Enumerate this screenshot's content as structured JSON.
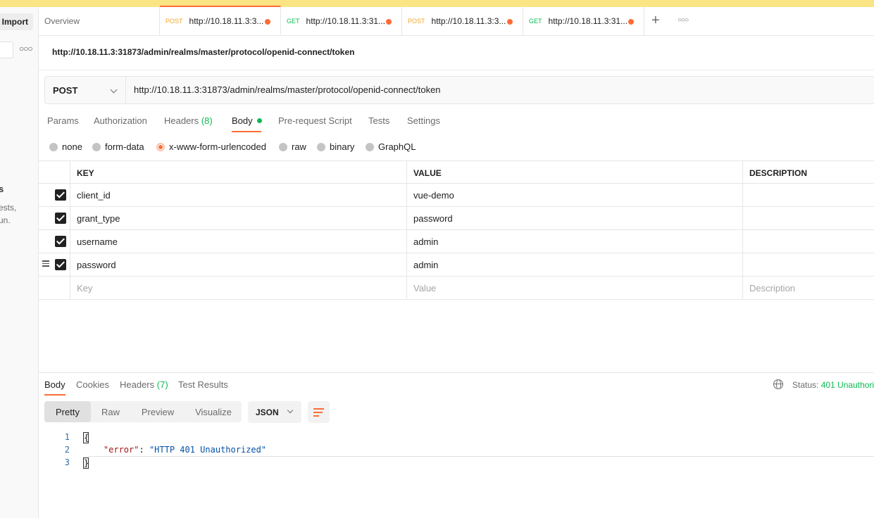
{
  "sidebar": {
    "import_label": "Import",
    "heading_fragment": "s",
    "text_line1": "ests,",
    "text_line2": "un."
  },
  "tabs": {
    "overview_label": "Overview",
    "items": [
      {
        "method": "POST",
        "url": "http://10.18.11.3:3..."
      },
      {
        "method": "GET",
        "url": "http://10.18.11.3:31..."
      },
      {
        "method": "POST",
        "url": "http://10.18.11.3:3..."
      },
      {
        "method": "GET",
        "url": "http://10.18.11.3:31..."
      }
    ]
  },
  "request": {
    "title": "http://10.18.11.3:31873/admin/realms/master/protocol/openid-connect/token",
    "method": "POST",
    "url": "http://10.18.11.3:31873/admin/realms/master/protocol/openid-connect/token",
    "tabs": {
      "params": "Params",
      "authorization": "Authorization",
      "headers": "Headers",
      "headers_count": "(8)",
      "body": "Body",
      "prerequest": "Pre-request Script",
      "tests": "Tests",
      "settings": "Settings"
    },
    "body_types": {
      "none": "none",
      "form_data": "form-data",
      "urlencoded": "x-www-form-urlencoded",
      "raw": "raw",
      "binary": "binary",
      "graphql": "GraphQL"
    },
    "table": {
      "headers": {
        "key": "KEY",
        "value": "VALUE",
        "description": "DESCRIPTION"
      },
      "rows": [
        {
          "key": "client_id",
          "value": "vue-demo"
        },
        {
          "key": "grant_type",
          "value": "password"
        },
        {
          "key": "username",
          "value": "admin"
        },
        {
          "key": "password",
          "value": "admin"
        }
      ],
      "placeholders": {
        "key": "Key",
        "value": "Value",
        "description": "Description"
      }
    }
  },
  "response": {
    "tabs": {
      "body": "Body",
      "cookies": "Cookies",
      "headers": "Headers",
      "headers_count": "(7)",
      "test_results": "Test Results"
    },
    "status_label": "Status:",
    "status_value": "401 Unauthori",
    "views": {
      "pretty": "Pretty",
      "raw": "Raw",
      "preview": "Preview",
      "visualize": "Visualize"
    },
    "format": "JSON",
    "code": {
      "line_numbers": [
        "1",
        "2",
        "3"
      ],
      "open_brace": "{",
      "json_key": "\"error\"",
      "colon": ": ",
      "json_value": "\"HTTP 401 Unauthorized\"",
      "close_brace": "}"
    }
  },
  "colors": {
    "accent": "#ff6c37",
    "get_method": "#0cbb52",
    "post_method": "#f5a623",
    "banner": "#fbe484"
  }
}
